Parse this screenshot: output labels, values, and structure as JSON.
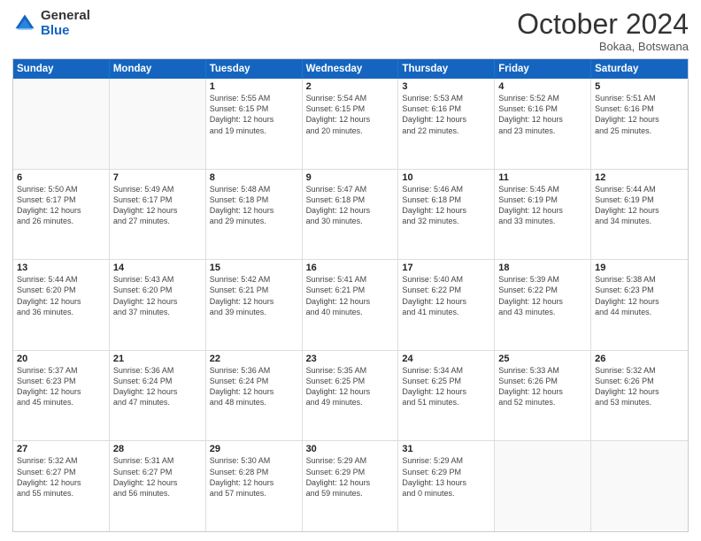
{
  "header": {
    "logo_general": "General",
    "logo_blue": "Blue",
    "month_title": "October 2024",
    "location": "Bokaa, Botswana"
  },
  "calendar": {
    "days_of_week": [
      "Sunday",
      "Monday",
      "Tuesday",
      "Wednesday",
      "Thursday",
      "Friday",
      "Saturday"
    ],
    "weeks": [
      [
        {
          "day": "",
          "info": ""
        },
        {
          "day": "",
          "info": ""
        },
        {
          "day": "1",
          "info": "Sunrise: 5:55 AM\nSunset: 6:15 PM\nDaylight: 12 hours\nand 19 minutes."
        },
        {
          "day": "2",
          "info": "Sunrise: 5:54 AM\nSunset: 6:15 PM\nDaylight: 12 hours\nand 20 minutes."
        },
        {
          "day": "3",
          "info": "Sunrise: 5:53 AM\nSunset: 6:16 PM\nDaylight: 12 hours\nand 22 minutes."
        },
        {
          "day": "4",
          "info": "Sunrise: 5:52 AM\nSunset: 6:16 PM\nDaylight: 12 hours\nand 23 minutes."
        },
        {
          "day": "5",
          "info": "Sunrise: 5:51 AM\nSunset: 6:16 PM\nDaylight: 12 hours\nand 25 minutes."
        }
      ],
      [
        {
          "day": "6",
          "info": "Sunrise: 5:50 AM\nSunset: 6:17 PM\nDaylight: 12 hours\nand 26 minutes."
        },
        {
          "day": "7",
          "info": "Sunrise: 5:49 AM\nSunset: 6:17 PM\nDaylight: 12 hours\nand 27 minutes."
        },
        {
          "day": "8",
          "info": "Sunrise: 5:48 AM\nSunset: 6:18 PM\nDaylight: 12 hours\nand 29 minutes."
        },
        {
          "day": "9",
          "info": "Sunrise: 5:47 AM\nSunset: 6:18 PM\nDaylight: 12 hours\nand 30 minutes."
        },
        {
          "day": "10",
          "info": "Sunrise: 5:46 AM\nSunset: 6:18 PM\nDaylight: 12 hours\nand 32 minutes."
        },
        {
          "day": "11",
          "info": "Sunrise: 5:45 AM\nSunset: 6:19 PM\nDaylight: 12 hours\nand 33 minutes."
        },
        {
          "day": "12",
          "info": "Sunrise: 5:44 AM\nSunset: 6:19 PM\nDaylight: 12 hours\nand 34 minutes."
        }
      ],
      [
        {
          "day": "13",
          "info": "Sunrise: 5:44 AM\nSunset: 6:20 PM\nDaylight: 12 hours\nand 36 minutes."
        },
        {
          "day": "14",
          "info": "Sunrise: 5:43 AM\nSunset: 6:20 PM\nDaylight: 12 hours\nand 37 minutes."
        },
        {
          "day": "15",
          "info": "Sunrise: 5:42 AM\nSunset: 6:21 PM\nDaylight: 12 hours\nand 39 minutes."
        },
        {
          "day": "16",
          "info": "Sunrise: 5:41 AM\nSunset: 6:21 PM\nDaylight: 12 hours\nand 40 minutes."
        },
        {
          "day": "17",
          "info": "Sunrise: 5:40 AM\nSunset: 6:22 PM\nDaylight: 12 hours\nand 41 minutes."
        },
        {
          "day": "18",
          "info": "Sunrise: 5:39 AM\nSunset: 6:22 PM\nDaylight: 12 hours\nand 43 minutes."
        },
        {
          "day": "19",
          "info": "Sunrise: 5:38 AM\nSunset: 6:23 PM\nDaylight: 12 hours\nand 44 minutes."
        }
      ],
      [
        {
          "day": "20",
          "info": "Sunrise: 5:37 AM\nSunset: 6:23 PM\nDaylight: 12 hours\nand 45 minutes."
        },
        {
          "day": "21",
          "info": "Sunrise: 5:36 AM\nSunset: 6:24 PM\nDaylight: 12 hours\nand 47 minutes."
        },
        {
          "day": "22",
          "info": "Sunrise: 5:36 AM\nSunset: 6:24 PM\nDaylight: 12 hours\nand 48 minutes."
        },
        {
          "day": "23",
          "info": "Sunrise: 5:35 AM\nSunset: 6:25 PM\nDaylight: 12 hours\nand 49 minutes."
        },
        {
          "day": "24",
          "info": "Sunrise: 5:34 AM\nSunset: 6:25 PM\nDaylight: 12 hours\nand 51 minutes."
        },
        {
          "day": "25",
          "info": "Sunrise: 5:33 AM\nSunset: 6:26 PM\nDaylight: 12 hours\nand 52 minutes."
        },
        {
          "day": "26",
          "info": "Sunrise: 5:32 AM\nSunset: 6:26 PM\nDaylight: 12 hours\nand 53 minutes."
        }
      ],
      [
        {
          "day": "27",
          "info": "Sunrise: 5:32 AM\nSunset: 6:27 PM\nDaylight: 12 hours\nand 55 minutes."
        },
        {
          "day": "28",
          "info": "Sunrise: 5:31 AM\nSunset: 6:27 PM\nDaylight: 12 hours\nand 56 minutes."
        },
        {
          "day": "29",
          "info": "Sunrise: 5:30 AM\nSunset: 6:28 PM\nDaylight: 12 hours\nand 57 minutes."
        },
        {
          "day": "30",
          "info": "Sunrise: 5:29 AM\nSunset: 6:29 PM\nDaylight: 12 hours\nand 59 minutes."
        },
        {
          "day": "31",
          "info": "Sunrise: 5:29 AM\nSunset: 6:29 PM\nDaylight: 13 hours\nand 0 minutes."
        },
        {
          "day": "",
          "info": ""
        },
        {
          "day": "",
          "info": ""
        }
      ]
    ]
  }
}
